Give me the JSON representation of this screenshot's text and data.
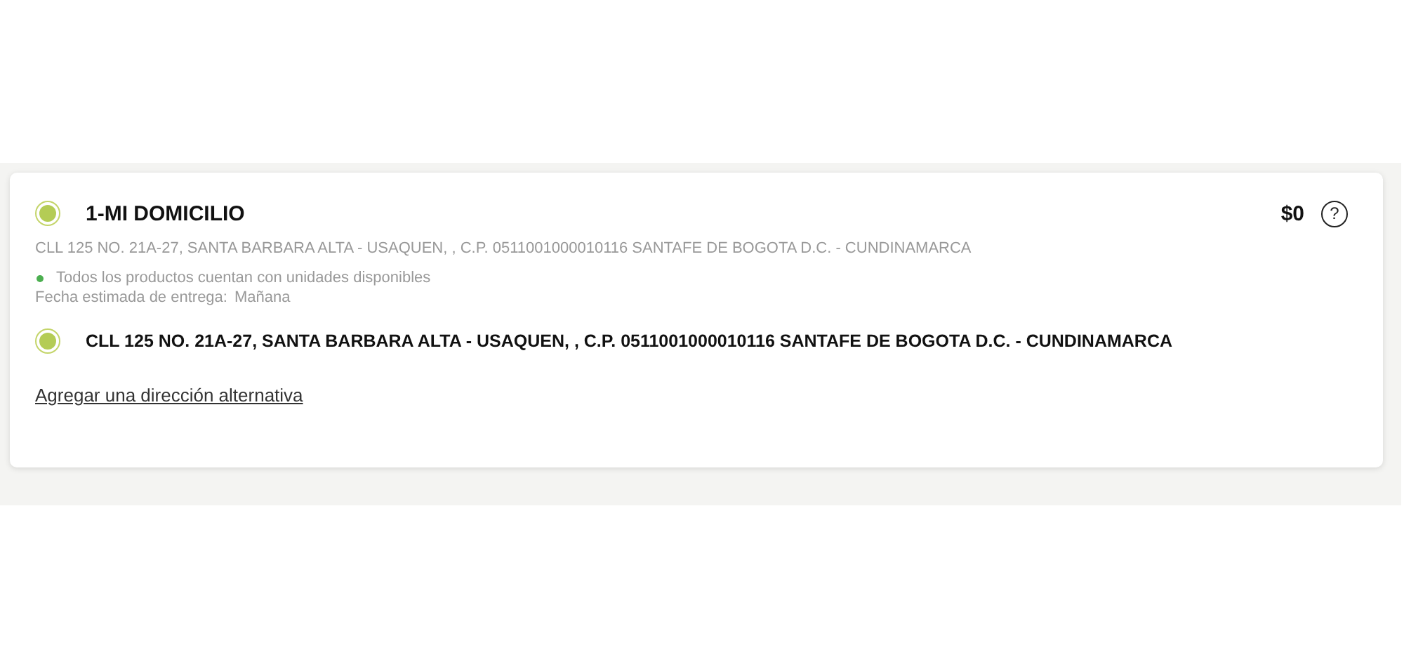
{
  "shipping_option": {
    "title": "1-MI DOMICILIO",
    "selected": true,
    "price": "$0",
    "help": "?",
    "address": "CLL 125 NO. 21A-27, SANTA BARBARA ALTA - USAQUEN, , C.P. 0511001000010116 SANTAFE DE BOGOTA D.C. - CUNDINAMARCA",
    "availability": {
      "text": "Todos los productos cuentan con unidades disponibles",
      "color": "#4caf50"
    },
    "delivery_label": "Fecha estimada de entrega:",
    "delivery_value": "Mañana"
  },
  "addresses": [
    {
      "text": "CLL 125 NO. 21A-27, SANTA BARBARA ALTA - USAQUEN, , C.P. 0511001000010116 SANTAFE DE BOGOTA D.C. - CUNDINAMARCA",
      "selected": true
    }
  ],
  "add_link": "Agregar una dirección alternativa"
}
